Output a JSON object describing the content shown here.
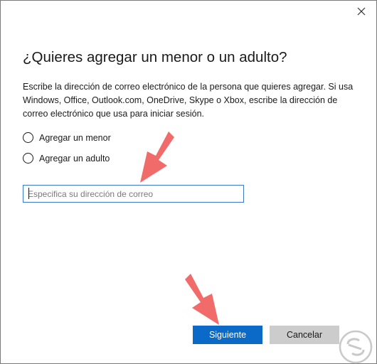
{
  "dialog": {
    "title": "¿Quieres agregar un menor o un adulto?",
    "description": "Escribe la dirección de correo electrónico de la persona que quieres agregar. Si usa Windows, Office, Outlook.com, OneDrive, Skype o Xbox, escribe la dirección de correo electrónico que usa para iniciar sesión."
  },
  "options": {
    "minor_label": "Agregar un menor",
    "adult_label": "Agregar un adulto"
  },
  "email": {
    "placeholder": "Especifica su dirección de correo",
    "value": ""
  },
  "buttons": {
    "next_label": "Siguiente",
    "cancel_label": "Cancelar"
  },
  "icons": {
    "close": "close-icon",
    "arrow": "red-arrow-icon",
    "watermark": "solvetic-logo"
  },
  "colors": {
    "primary_button": "#0b6ac7",
    "secondary_button": "#cccccc",
    "input_border": "#3b79c7",
    "annotation_arrow": "#f26b6b"
  }
}
